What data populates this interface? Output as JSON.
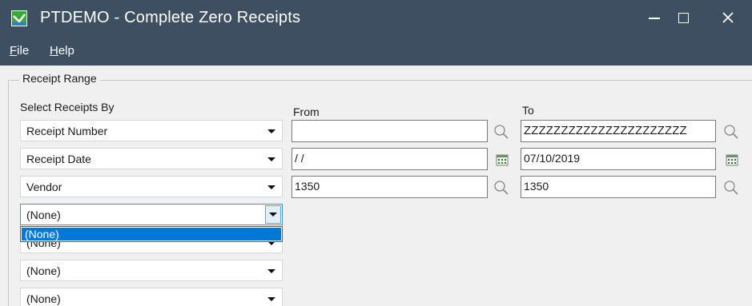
{
  "window": {
    "title": "PTDEMO - Complete Zero Receipts",
    "controls": {
      "minimize": "minimize",
      "maximize": "maximize",
      "close": "close"
    }
  },
  "menu": {
    "file": {
      "underline": "F",
      "rest": "ile"
    },
    "help": {
      "underline": "H",
      "rest": "elp"
    }
  },
  "receipt_range": {
    "legend": "Receipt Range",
    "select_label": "Select Receipts By",
    "from_label": "From",
    "to_label": "To",
    "rows": [
      {
        "criteria": "Receipt Number",
        "from": "",
        "to": "ZZZZZZZZZZZZZZZZZZZZZZ",
        "lookup": "search-icon"
      },
      {
        "criteria": "Receipt Date",
        "from": " / /",
        "to": "07/10/2019",
        "lookup": "calendar-icon"
      },
      {
        "criteria": "Vendor",
        "from": "1350",
        "to": "1350",
        "lookup": "search-icon"
      },
      {
        "criteria": "(None)"
      },
      {
        "criteria": "(None)"
      },
      {
        "criteria": "(None)"
      },
      {
        "criteria": "(None)"
      }
    ],
    "dropdown_open": {
      "highlighted_option": "(None)"
    }
  },
  "colors": {
    "titlebar": "#3e4f61",
    "selection": "#0078d7",
    "icon_green": "#3aa935"
  }
}
